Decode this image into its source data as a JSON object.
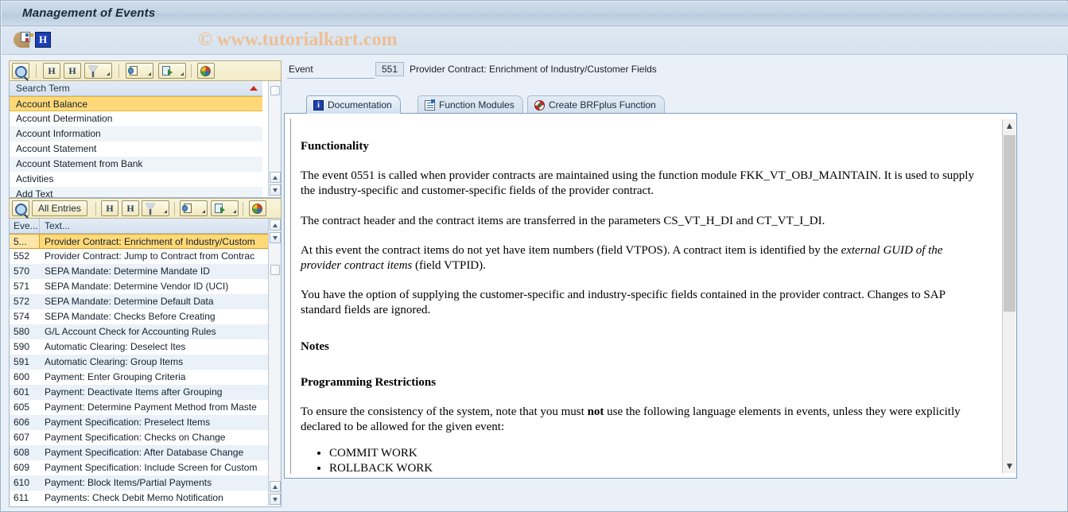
{
  "window": {
    "title": "Management of Events",
    "watermark": "© www.tutorialkart.com"
  },
  "app_toolbar": {
    "buttons": [
      {
        "name": "variant-icon",
        "tooltip": "Maintain Variants"
      },
      {
        "name": "info-icon",
        "label": "H",
        "tooltip": "Information"
      }
    ]
  },
  "left_panel": {
    "search_toolbar": {
      "buttons": [
        {
          "name": "find-search-term-icon"
        },
        {
          "name": "find-icon"
        },
        {
          "name": "find-next-icon"
        },
        {
          "name": "filter-icon"
        },
        {
          "name": "details-icon"
        },
        {
          "name": "export-icon"
        },
        {
          "name": "graphic-icon"
        }
      ]
    },
    "search_list": {
      "header": "Search Term",
      "rows": [
        "Account Balance",
        "Account Determination",
        "Account Information",
        "Account Statement",
        "Account Statement from Bank",
        "Activities",
        "Add Text"
      ],
      "selected_index": 0
    },
    "entries_toolbar": {
      "all_entries_label": "All Entries",
      "buttons": [
        {
          "name": "find-entry-icon"
        },
        {
          "name": "find-icon"
        },
        {
          "name": "find-next-icon"
        },
        {
          "name": "filter-icon"
        },
        {
          "name": "details-icon"
        },
        {
          "name": "export-icon"
        },
        {
          "name": "graphic-icon"
        }
      ]
    },
    "entries_grid": {
      "columns": [
        "Eve...",
        "Text..."
      ],
      "selected_index": 0,
      "rows": [
        {
          "id": "5...",
          "text": "Provider Contract: Enrichment of Industry/Custom"
        },
        {
          "id": "552",
          "text": "Provider Contract: Jump to Contract from Contrac"
        },
        {
          "id": "570",
          "text": "SEPA Mandate: Determine Mandate ID"
        },
        {
          "id": "571",
          "text": "SEPA Mandate: Determine Vendor ID (UCI)"
        },
        {
          "id": "572",
          "text": "SEPA Mandate: Determine Default Data"
        },
        {
          "id": "574",
          "text": "SEPA Mandate: Checks Before Creating"
        },
        {
          "id": "580",
          "text": "G/L Account Check for Accounting Rules"
        },
        {
          "id": "590",
          "text": "Automatic Clearing: Deselect Ites"
        },
        {
          "id": "591",
          "text": "Automatic Clearing: Group Items"
        },
        {
          "id": "600",
          "text": "Payment: Enter Grouping Criteria"
        },
        {
          "id": "601",
          "text": "Payment: Deactivate Items after Grouping"
        },
        {
          "id": "605",
          "text": "Payment: Determine Payment Method from Maste"
        },
        {
          "id": "606",
          "text": "Payment Specification: Preselect Items"
        },
        {
          "id": "607",
          "text": "Payment Specification: Checks on Change"
        },
        {
          "id": "608",
          "text": "Payment Specification: After Database Change"
        },
        {
          "id": "609",
          "text": "Payment Specification: Include Screen for Custom"
        },
        {
          "id": "610",
          "text": "Payment: Block Items/Partial Payments"
        },
        {
          "id": "611",
          "text": "Payments: Check Debit Memo Notification"
        }
      ]
    }
  },
  "right_panel": {
    "event_label": "Event",
    "event_id": "551",
    "event_description": "Provider Contract: Enrichment of Industry/Customer Fields",
    "tabs": [
      {
        "label": "Documentation",
        "icon": "info-icon",
        "active": true
      },
      {
        "label": "Function Modules",
        "icon": "list-icon",
        "active": false
      },
      {
        "label": "Create BRFplus Function",
        "icon": "brfplus-icon",
        "active": false
      }
    ],
    "documentation": {
      "heading_functionality": "Functionality",
      "para_1_a": "The event 0551 is called when provider contracts are maintained using the function module FKK_VT_OBJ_MAINTAIN. It is used to supply the industry-specific and customer-specific fields of the provider contract.",
      "para_2": "The contract header and the contract items are transferred in the parameters CS_VT_H_DI and CT_VT_I_DI.",
      "para_3_pre": "At this event the contract items do not yet have item numbers (field VTPOS). A contract item is identified by the ",
      "para_3_em": "external GUID of the provider contract items",
      "para_3_post": " (field VTPID).",
      "para_4": "You have the option of supplying the customer-specific and industry-specific fields contained in the provider contract. Changes to SAP standard fields are ignored.",
      "heading_notes": "Notes",
      "heading_restrictions": "Programming Restrictions",
      "para_5_pre": "To ensure the consistency of the system, note that you must ",
      "para_5_bold": "not",
      "para_5_post": " use the following language elements in events, unless they were explicitly declared to be allowed for the given event:",
      "bullets": [
        "COMMIT WORK",
        "ROLLBACK WORK"
      ]
    }
  },
  "colors": {
    "title_bar": "#c3d3e4",
    "panel_background": "#e9f0f7",
    "selection_highlight": "#ffd978",
    "toolbar_yellow": "#f3ecc7",
    "watermark": "#edbf95",
    "accent_blue": "#1b3fb0"
  }
}
